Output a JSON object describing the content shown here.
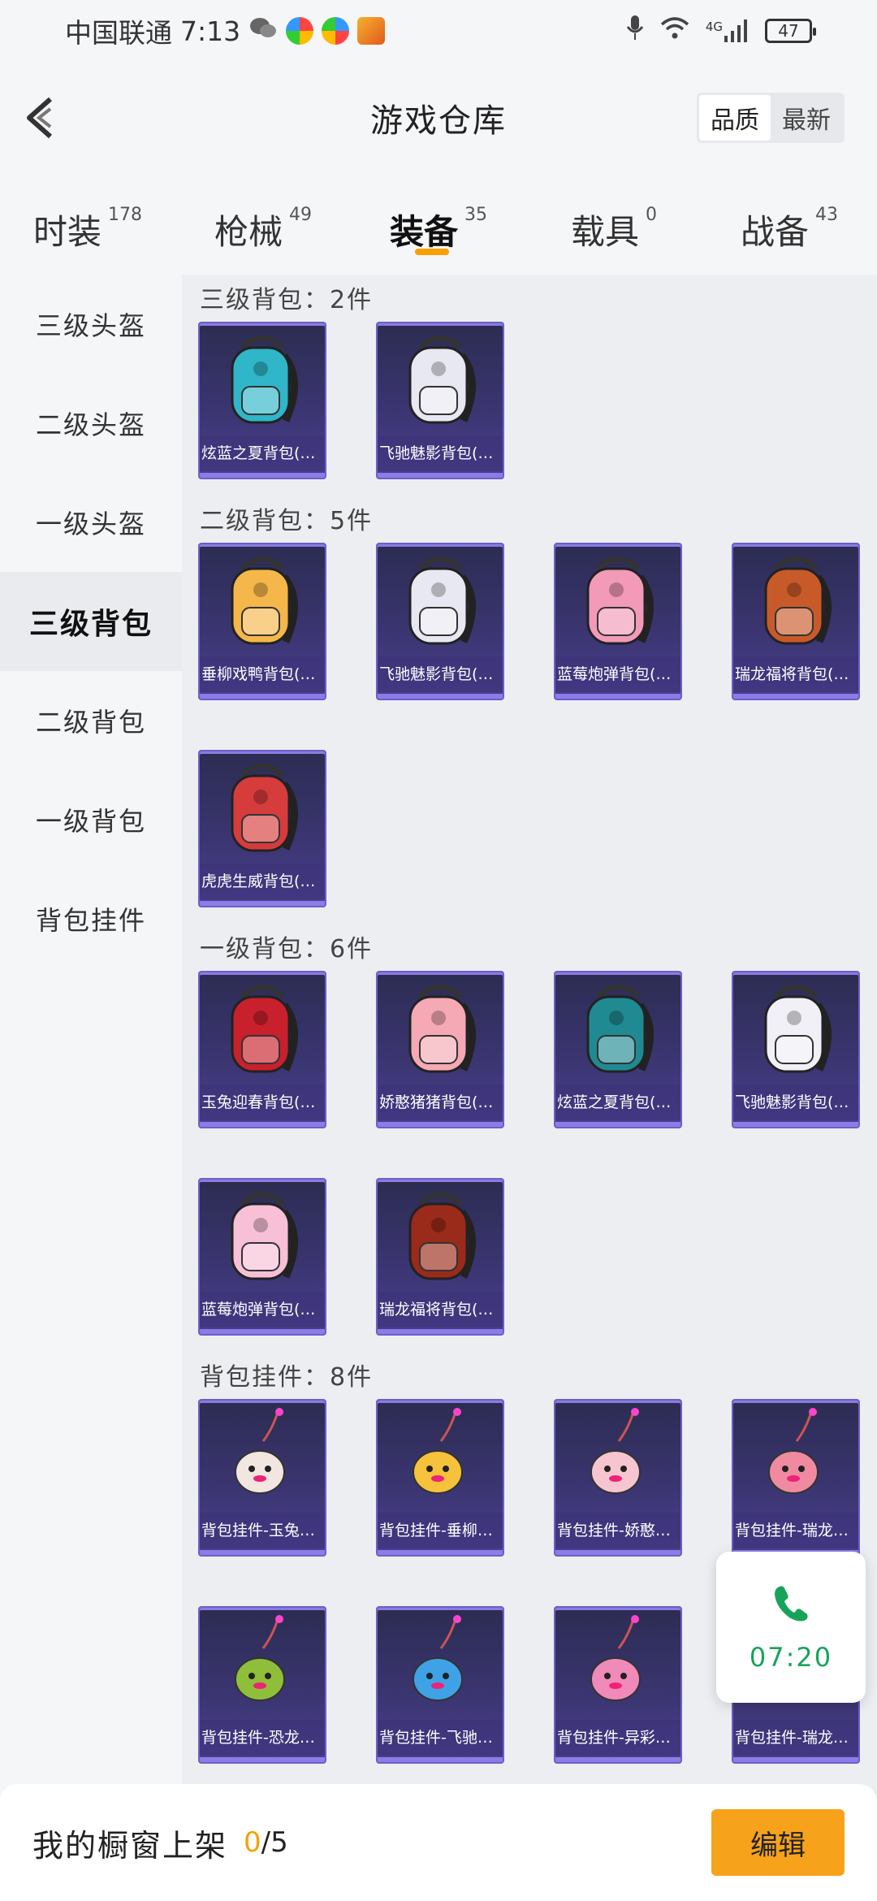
{
  "status_bar": {
    "carrier": "中国联通",
    "time": "7:13",
    "network": "4G",
    "battery": "47"
  },
  "header": {
    "title": "游戏仓库",
    "sort_options": [
      "品质",
      "最新"
    ],
    "sort_active": "品质"
  },
  "tabs": [
    {
      "label": "时装",
      "count": "178"
    },
    {
      "label": "枪械",
      "count": "49"
    },
    {
      "label": "装备",
      "count": "35"
    },
    {
      "label": "载具",
      "count": "0"
    },
    {
      "label": "战备",
      "count": "43"
    }
  ],
  "sidebar": {
    "items": [
      {
        "label": "三级头盔"
      },
      {
        "label": "二级头盔"
      },
      {
        "label": "一级头盔"
      },
      {
        "label": "三级背包"
      },
      {
        "label": "二级背包"
      },
      {
        "label": "一级背包"
      },
      {
        "label": "背包挂件"
      }
    ],
    "active": "三级背包"
  },
  "sections": [
    {
      "title": "三级背包：2件",
      "items": [
        {
          "label": "炫蓝之夏背包(3…",
          "icon": "backpack-icon",
          "color": "#2fb6c8"
        },
        {
          "label": "飞驰魅影背包(3…",
          "icon": "backpack-icon",
          "color": "#e8e8f2"
        }
      ]
    },
    {
      "title": "二级背包：5件",
      "items": [
        {
          "label": "垂柳戏鸭背包(2…",
          "icon": "backpack-icon",
          "color": "#f5b74a"
        },
        {
          "label": "飞驰魅影背包(2…",
          "icon": "backpack-icon",
          "color": "#e8e8f2"
        },
        {
          "label": "蓝莓炮弹背包(2…",
          "icon": "backpack-icon",
          "color": "#f29ab8"
        },
        {
          "label": "瑞龙福将背包(2…",
          "icon": "backpack-icon",
          "color": "#c85a2a"
        },
        {
          "label": "虎虎生威背包(2…",
          "icon": "backpack-icon",
          "color": "#d63c3c"
        }
      ]
    },
    {
      "title": "一级背包：6件",
      "items": [
        {
          "label": "玉兔迎春背包(1…",
          "icon": "backpack-icon",
          "color": "#c8202c"
        },
        {
          "label": "娇憨猪猪背包(1…",
          "icon": "backpack-icon",
          "color": "#f4a9b4"
        },
        {
          "label": "炫蓝之夏背包(1…",
          "icon": "backpack-icon",
          "color": "#1f8a92"
        },
        {
          "label": "飞驰魅影背包(1…",
          "icon": "backpack-icon",
          "color": "#f0f0f6"
        },
        {
          "label": "蓝莓炮弹背包(1…",
          "icon": "backpack-icon",
          "color": "#f7c0d6"
        },
        {
          "label": "瑞龙福将背包(1…",
          "icon": "backpack-icon",
          "color": "#9a2a1a"
        }
      ]
    },
    {
      "title": "背包挂件：8件",
      "items": [
        {
          "label": "背包挂件-玉兔…",
          "icon": "charm-icon",
          "color": "#f2e6e0"
        },
        {
          "label": "背包挂件-垂柳…",
          "icon": "charm-icon",
          "color": "#f6c23c"
        },
        {
          "label": "背包挂件-娇憨…",
          "icon": "charm-icon",
          "color": "#f7c5cf"
        },
        {
          "label": "背包挂件-瑞龙…",
          "icon": "charm-icon",
          "color": "#f08aa0"
        },
        {
          "label": "背包挂件-恐龙…",
          "icon": "charm-icon",
          "color": "#8fbf3a"
        },
        {
          "label": "背包挂件-飞驰…",
          "icon": "charm-icon",
          "color": "#3fa2e6"
        },
        {
          "label": "背包挂件-异彩…",
          "icon": "charm-icon",
          "color": "#f08ab8"
        },
        {
          "label": "背包挂件-瑞龙…",
          "icon": "charm-icon",
          "color": "#d4902a"
        }
      ]
    }
  ],
  "call_widget": {
    "time": "07:20",
    "icon": "phone-icon"
  },
  "bottom_bar": {
    "label": "我的橱窗上架",
    "used": "0",
    "total": "/5",
    "edit_label": "编辑"
  },
  "colors": {
    "accent": "#f5a100",
    "call_green": "#18a35a",
    "card_purple": "#3a3570"
  }
}
